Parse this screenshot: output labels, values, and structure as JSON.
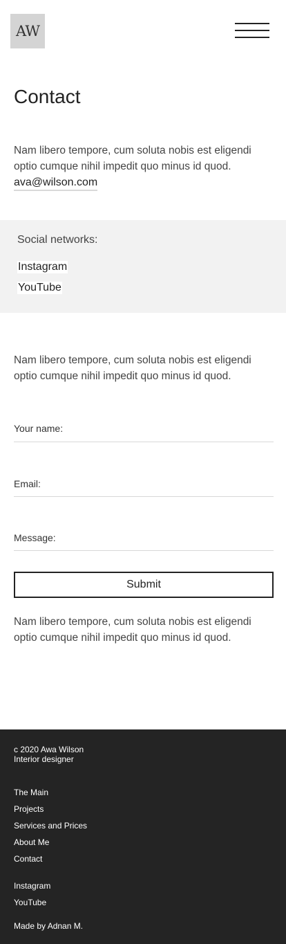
{
  "header": {
    "logo_text": "AW",
    "menu_icon": "hamburger-menu-icon"
  },
  "main": {
    "title": "Contact",
    "intro_text": "Nam libero tempore, cum soluta nobis est eligendi optio cumque nihil impedit quo minus id quod.",
    "email": "ava@wilson.com",
    "social": {
      "heading": "Social networks:",
      "links": [
        "Instagram",
        "YouTube"
      ]
    },
    "form_intro": "Nam libero tempore, cum soluta nobis est eligendi optio cumque nihil impedit quo minus id quod.",
    "form": {
      "name_label": "Your name:",
      "email_label": "Email:",
      "message_label": "Message:",
      "submit_label": "Submit"
    },
    "outro_text": "Nam libero tempore, cum soluta nobis est eligendi optio cumque nihil impedit quo minus id quod."
  },
  "footer": {
    "copyright": "c 2020 Awa Wilson",
    "role": "Interior designer",
    "nav": [
      "The Main",
      "Projects",
      "Services and Prices",
      "About Me",
      "Contact"
    ],
    "social": [
      "Instagram",
      "YouTube"
    ],
    "credit": "Made by Adnan M."
  },
  "colors": {
    "background": "#ffffff",
    "social_panel": "#f2f2f2",
    "footer": "#242424",
    "text": "#222222",
    "logo_bg": "#d4d4d4"
  }
}
